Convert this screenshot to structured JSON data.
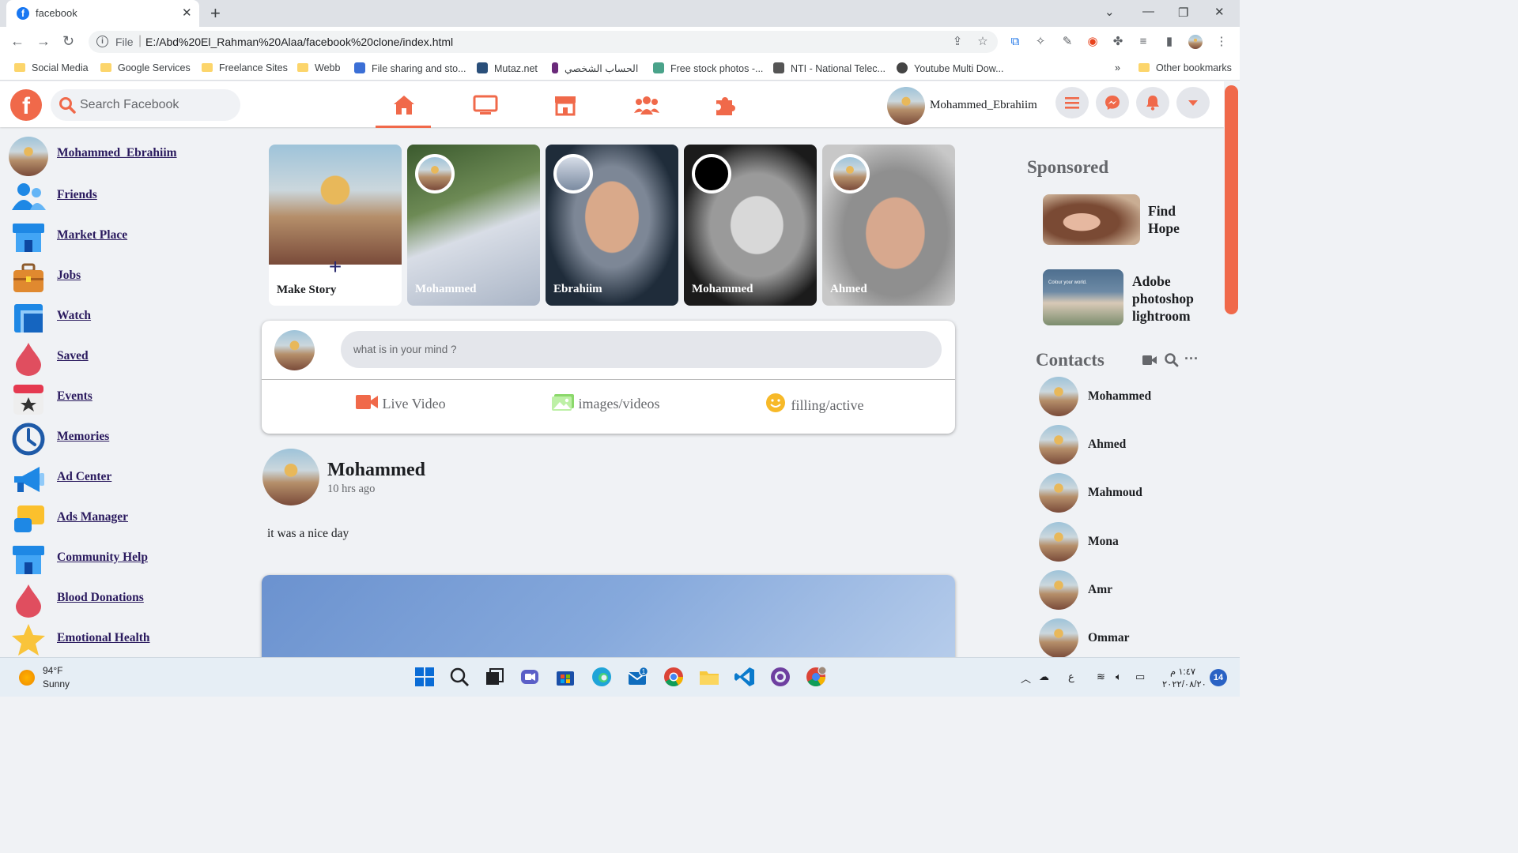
{
  "browser": {
    "tab_title": "facebook",
    "tab_favicon": "f",
    "url_scheme": "File",
    "url": "E:/Abd%20El_Rahman%20Alaa/facebook%20clone/index.html",
    "bookmarks": [
      {
        "label": "Social Media",
        "icon": "folder-icon"
      },
      {
        "label": "Google Services",
        "icon": "folder-icon"
      },
      {
        "label": "Freelance Sites",
        "icon": "folder-icon"
      },
      {
        "label": "Webb",
        "icon": "folder-icon"
      },
      {
        "label": "File sharing and sto...",
        "icon": "site-icon"
      },
      {
        "label": "Mutaz.net",
        "icon": "site-icon"
      },
      {
        "label": "الحساب الشخصي",
        "icon": "site-icon"
      },
      {
        "label": "Free stock photos -...",
        "icon": "site-icon"
      },
      {
        "label": "NTI - National Telec...",
        "icon": "site-icon"
      },
      {
        "label": "Youtube Multi Dow...",
        "icon": "site-icon"
      }
    ],
    "bookmarks_overflow": "»",
    "other_bookmarks": "Other bookmarks"
  },
  "header": {
    "logo": "f",
    "search_placeholder": "Search Facebook",
    "profile_name": "Mohammed_Ebrahiim",
    "accent": "#f0694a"
  },
  "sidebar": {
    "items": [
      {
        "label": "Mohammed_Ebrahiim",
        "icon": "avatar"
      },
      {
        "label": "Friends",
        "icon": "friends-icon"
      },
      {
        "label": "Market Place",
        "icon": "marketplace-icon"
      },
      {
        "label": "Jobs",
        "icon": "jobs-icon"
      },
      {
        "label": "Watch",
        "icon": "watch-icon"
      },
      {
        "label": "Saved",
        "icon": "saved-icon"
      },
      {
        "label": "Events",
        "icon": "events-icon"
      },
      {
        "label": "Memories",
        "icon": "memories-icon"
      },
      {
        "label": "Ad Center",
        "icon": "ad-center-icon"
      },
      {
        "label": "Ads Manager",
        "icon": "ads-manager-icon"
      },
      {
        "label": "Community Help",
        "icon": "community-help-icon"
      },
      {
        "label": "Blood Donations",
        "icon": "blood-donations-icon"
      },
      {
        "label": "Emotional Health",
        "icon": "emotional-health-icon"
      }
    ]
  },
  "stories": {
    "make_story": "Make Story",
    "items": [
      "Mohammed",
      "Ebrahiim",
      "Mohammed",
      "Ahmed"
    ]
  },
  "composer": {
    "placeholder": "what is in your mind ?",
    "actions": [
      "Live Video",
      "images/videos",
      "filling/active"
    ]
  },
  "post": {
    "author": "Mohammed",
    "time": "10 hrs ago",
    "text": "it was a nice day"
  },
  "right": {
    "sponsored_title": "Sponsored",
    "ads": [
      {
        "lines": [
          "Find",
          "Hope"
        ]
      },
      {
        "lines": [
          "Adobe",
          "photoshop",
          "lightroom"
        ],
        "image_caption": "Colour your world."
      }
    ],
    "contacts_title": "Contacts",
    "contacts": [
      "Mohammed",
      "Ahmed",
      "Mahmoud",
      "Mona",
      "Amr",
      "Ommar"
    ],
    "contact_tools_more": "···"
  },
  "taskbar": {
    "weather_temp": "94°F",
    "weather_cond": "Sunny",
    "lang": "ع",
    "time": "١:٤٧ م",
    "date": "٢٠٢٢/٠٨/٢٠",
    "notifications": "14",
    "mail_badge": "1"
  }
}
